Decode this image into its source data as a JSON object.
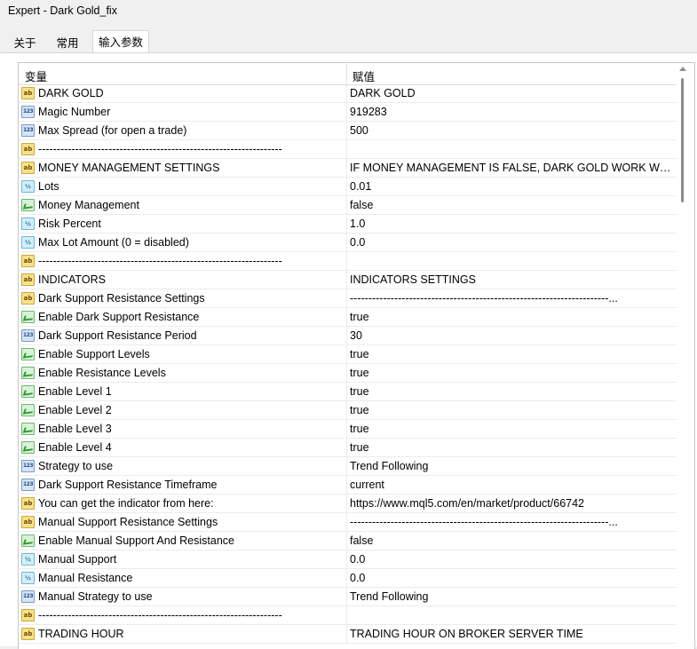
{
  "window": {
    "title": "Expert - Dark Gold_fix"
  },
  "tabs": [
    {
      "label": "关于"
    },
    {
      "label": "常用"
    },
    {
      "label": "输入参数"
    }
  ],
  "grid": {
    "col_variable": "变量",
    "col_value": "赋值"
  },
  "rows": [
    {
      "icon": "ab",
      "name": "DARK GOLD",
      "value": "DARK GOLD"
    },
    {
      "icon": "123",
      "name": "Magic Number",
      "value": "919283"
    },
    {
      "icon": "123",
      "name": "Max Spread (for open a trade)",
      "value": "500"
    },
    {
      "icon": "ab",
      "name": "------------------------------------------------------------------",
      "value": ""
    },
    {
      "icon": "ab",
      "name": "MONEY MANAGEMENT SETTINGS",
      "value": "IF MONEY MANAGEMENT IS FALSE, DARK GOLD WORK WIT..."
    },
    {
      "icon": "v2",
      "name": "Lots",
      "value": "0.01"
    },
    {
      "icon": "bool",
      "name": "Money Management",
      "value": "false"
    },
    {
      "icon": "v2",
      "name": "Risk Percent",
      "value": "1.0"
    },
    {
      "icon": "v2",
      "name": "Max Lot Amount (0 = disabled)",
      "value": "0.0"
    },
    {
      "icon": "ab",
      "name": "------------------------------------------------------------------",
      "value": ""
    },
    {
      "icon": "ab",
      "name": "INDICATORS",
      "value": "INDICATORS SETTINGS"
    },
    {
      "icon": "ab",
      "name": "Dark Support Resistance Settings",
      "value": "----------------------------------------------------------------------..."
    },
    {
      "icon": "bool",
      "name": "Enable Dark Support Resistance",
      "value": "true"
    },
    {
      "icon": "123",
      "name": "Dark Support Resistance Period",
      "value": "30"
    },
    {
      "icon": "bool",
      "name": "Enable Support Levels",
      "value": "true"
    },
    {
      "icon": "bool",
      "name": "Enable Resistance Levels",
      "value": "true"
    },
    {
      "icon": "bool",
      "name": "Enable Level 1",
      "value": "true"
    },
    {
      "icon": "bool",
      "name": "Enable Level 2",
      "value": "true"
    },
    {
      "icon": "bool",
      "name": "Enable Level 3",
      "value": "true"
    },
    {
      "icon": "bool",
      "name": "Enable Level 4",
      "value": "true"
    },
    {
      "icon": "123",
      "name": "Strategy to use",
      "value": "Trend Following"
    },
    {
      "icon": "123",
      "name": "Dark Support Resistance Timeframe",
      "value": "current"
    },
    {
      "icon": "ab",
      "name": "You can get the indicator from here:",
      "value": "https://www.mql5.com/en/market/product/66742"
    },
    {
      "icon": "ab",
      "name": "Manual Support Resistance Settings",
      "value": "----------------------------------------------------------------------..."
    },
    {
      "icon": "bool",
      "name": "Enable Manual Support And Resistance",
      "value": "false"
    },
    {
      "icon": "v2",
      "name": "Manual Support",
      "value": "0.0"
    },
    {
      "icon": "v2",
      "name": "Manual Resistance",
      "value": "0.0"
    },
    {
      "icon": "123",
      "name": "Manual Strategy to use",
      "value": "Trend Following"
    },
    {
      "icon": "ab",
      "name": "------------------------------------------------------------------",
      "value": ""
    },
    {
      "icon": "ab",
      "name": "TRADING HOUR",
      "value": "TRADING HOUR ON BROKER SERVER TIME"
    }
  ]
}
